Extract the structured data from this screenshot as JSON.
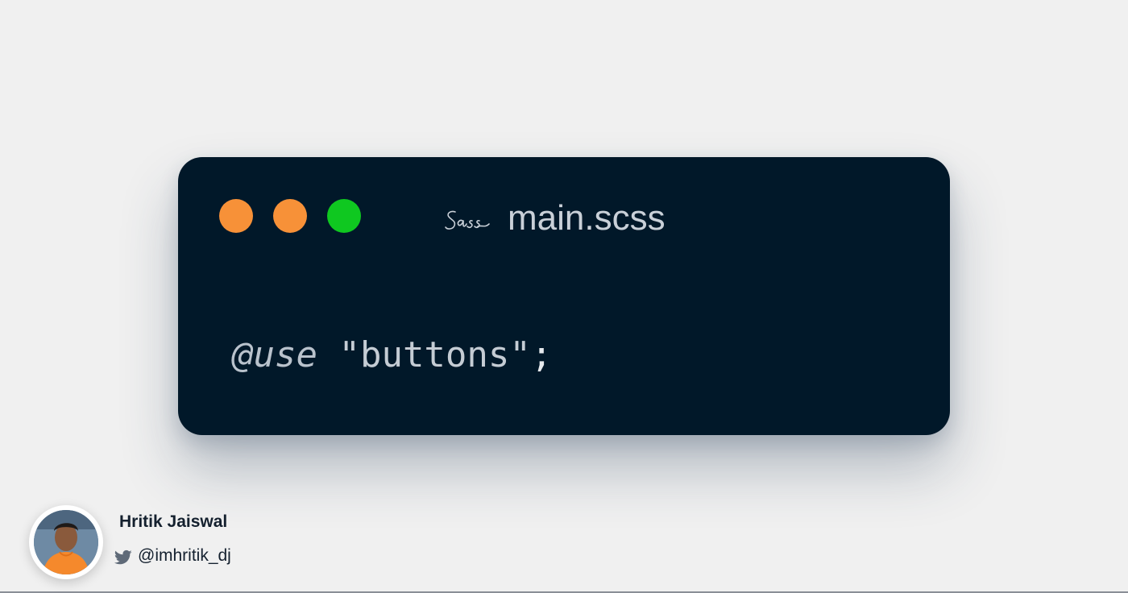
{
  "window": {
    "filename": "main.scss",
    "logo_icon": "sass-logo-icon",
    "traffic_lights": {
      "first_color": "#F79138",
      "second_color": "#F79138",
      "third_color": "#0FC820"
    },
    "background_color": "#011829"
  },
  "code": {
    "keyword": "@use",
    "string": "\"buttons\"",
    "terminator": ";"
  },
  "author": {
    "name": "Hritik Jaiswal",
    "handle": "@imhritik_dj",
    "handle_icon": "twitter-bird-icon"
  },
  "page": {
    "background_color": "#F0F0F0"
  }
}
